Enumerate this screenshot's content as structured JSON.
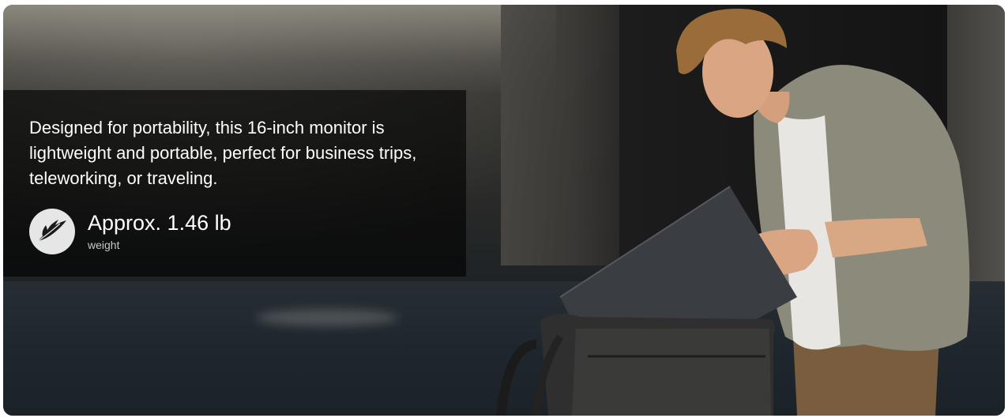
{
  "banner": {
    "description": "Designed for portability, this 16-inch monitor is lightweight and portable, perfect for business trips, teleworking, or traveling.",
    "spec": {
      "icon": "feather-icon",
      "value": "Approx. 1.46 lb",
      "label": "weight"
    },
    "image": "man-placing-monitor-in-bag-photo"
  },
  "colors": {
    "panel_overlay": "#000000",
    "text_primary": "#ffffff",
    "text_secondary": "#c8c8c8",
    "icon_circle": "#e6e6e6"
  }
}
